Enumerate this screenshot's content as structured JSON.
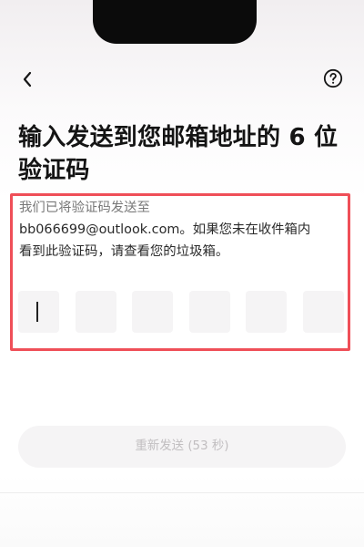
{
  "header": {
    "back_icon": "back-icon",
    "help_icon": "help-icon"
  },
  "title": "输入发送到您邮箱地址的 6 位验证码",
  "description": {
    "line1": "我们已将验证码发送至",
    "line2": "bb066699@outlook.com。如果您未在收件箱内",
    "line3": "看到此验证码，请查看您的垃圾箱。"
  },
  "code_input": {
    "digits": [
      "",
      "",
      "",
      "",
      "",
      ""
    ],
    "cursor_in_box": 1
  },
  "resend": {
    "label": "重新发送 (53 秒)"
  },
  "colors": {
    "highlight_border": "#ef4f58",
    "input_bg": "#f5f4f5",
    "disabled_text": "#c1bec0"
  }
}
